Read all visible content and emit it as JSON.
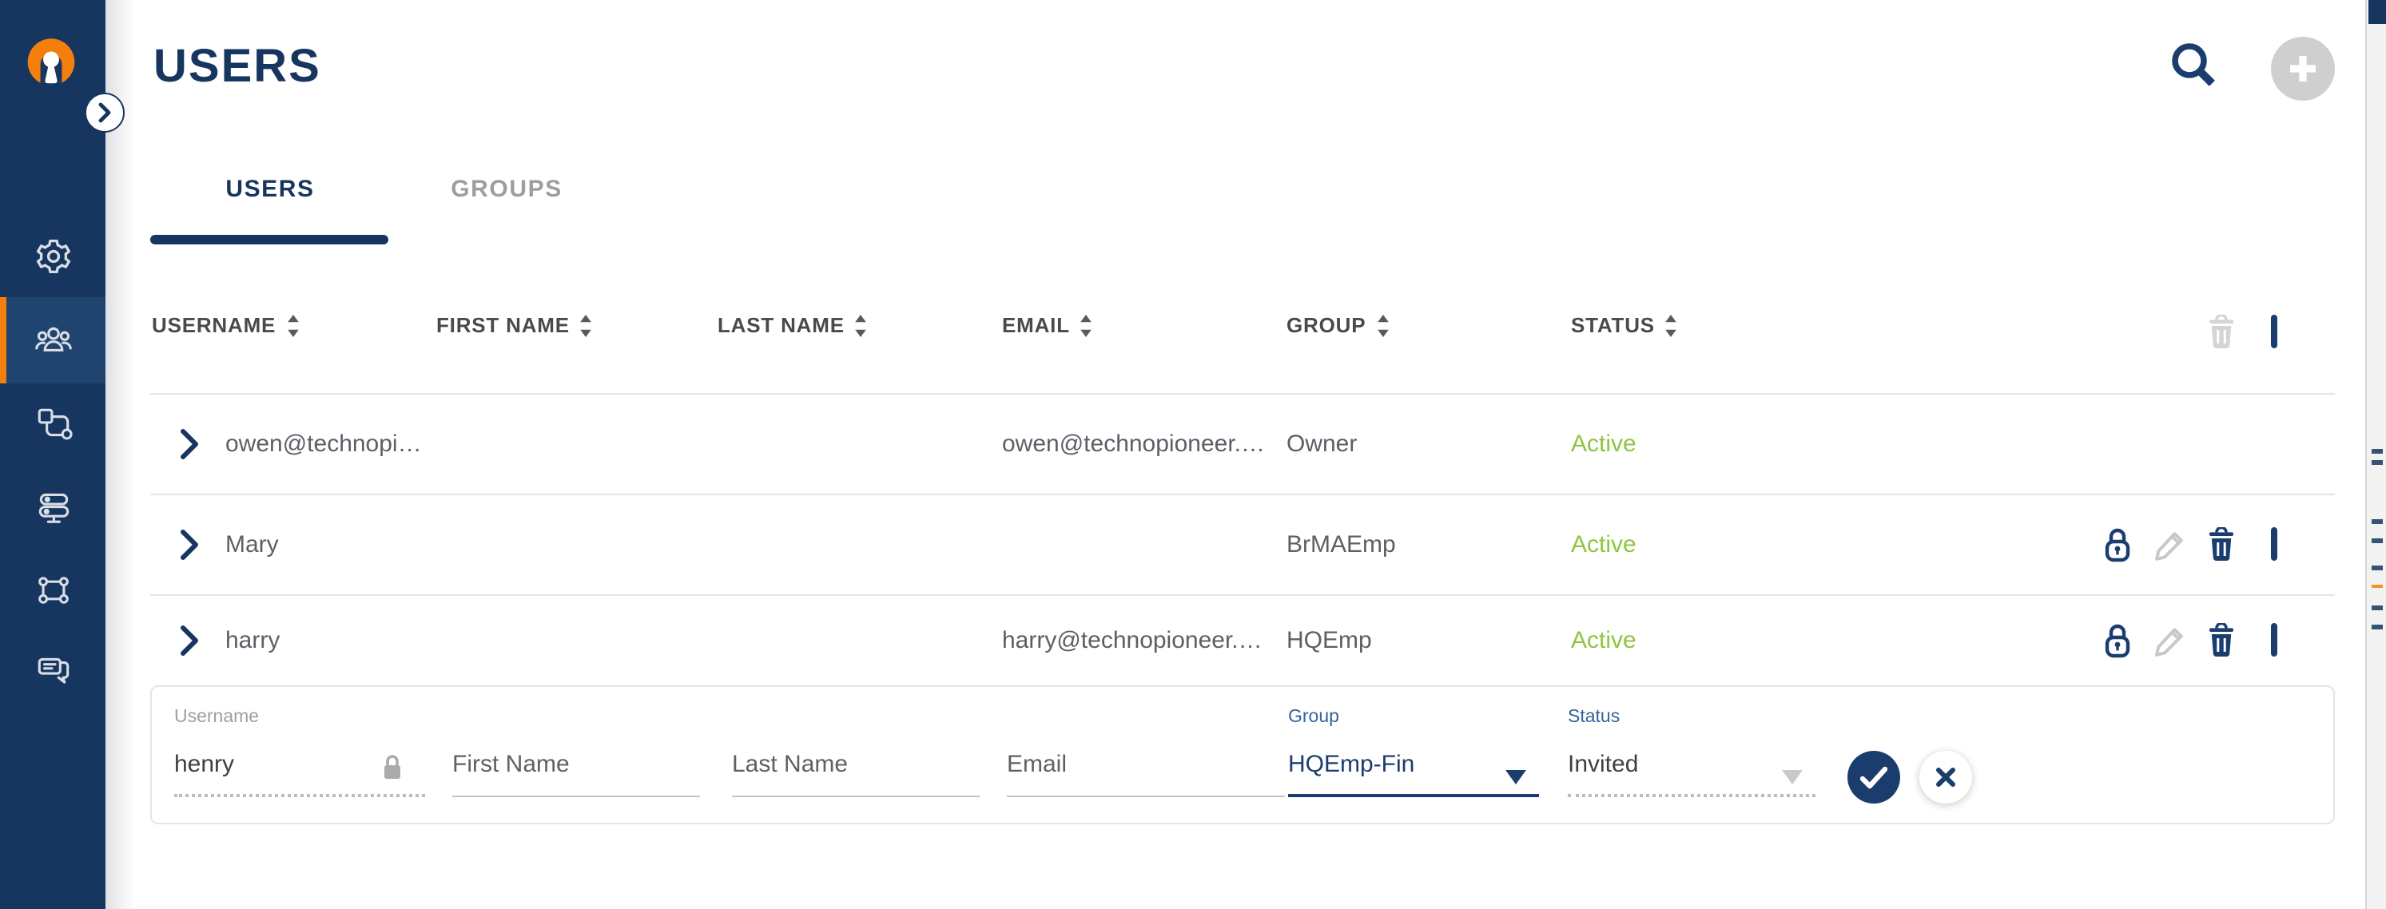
{
  "colors": {
    "navy": "#1B3D6E",
    "navy_dark": "#17365F",
    "orange": "#F57F0D",
    "green": "#8CC63F"
  },
  "header": {
    "title": "USERS",
    "search_icon": "search-icon",
    "add_icon": "plus-icon",
    "add_enabled": false
  },
  "sidebar": {
    "logo_icon": "openvpn-logo",
    "expand_icon": "chevron-right-icon",
    "items": [
      {
        "id": "settings",
        "icon": "gear-icon",
        "active": false
      },
      {
        "id": "users",
        "icon": "users-group-icon",
        "active": true
      },
      {
        "id": "templates",
        "icon": "shapes-icon",
        "active": false
      },
      {
        "id": "servers",
        "icon": "server-rack-icon",
        "active": false
      },
      {
        "id": "network",
        "icon": "topology-icon",
        "active": false
      },
      {
        "id": "messages",
        "icon": "chat-bubbles-icon",
        "active": false
      }
    ]
  },
  "tabs": [
    {
      "label": "USERS",
      "active": true
    },
    {
      "label": "GROUPS",
      "active": false
    }
  ],
  "table": {
    "columns": [
      "USERNAME",
      "FIRST NAME",
      "LAST NAME",
      "EMAIL",
      "GROUP",
      "STATUS"
    ],
    "rows": [
      {
        "username": "owen@technopi…",
        "first_name": "",
        "last_name": "",
        "email": "owen@technopioneer.…",
        "group": "Owner",
        "status": "Active",
        "has_actions": false
      },
      {
        "username": "Mary",
        "first_name": "",
        "last_name": "",
        "email": "",
        "group": "BrMAEmp",
        "status": "Active",
        "has_actions": true
      },
      {
        "username": "harry",
        "first_name": "",
        "last_name": "",
        "email": "harry@technopioneer.…",
        "group": "HQEmp",
        "status": "Active",
        "has_actions": true
      }
    ]
  },
  "edit_row": {
    "username": {
      "label": "Username",
      "value": "henry",
      "readonly": true
    },
    "first_name": {
      "placeholder": "First Name"
    },
    "last_name": {
      "placeholder": "Last Name"
    },
    "email": {
      "placeholder": "Email"
    },
    "group": {
      "label": "Group",
      "value": "HQEmp-Fin"
    },
    "status": {
      "label": "Status",
      "value": "Invited",
      "disabled": true
    }
  }
}
